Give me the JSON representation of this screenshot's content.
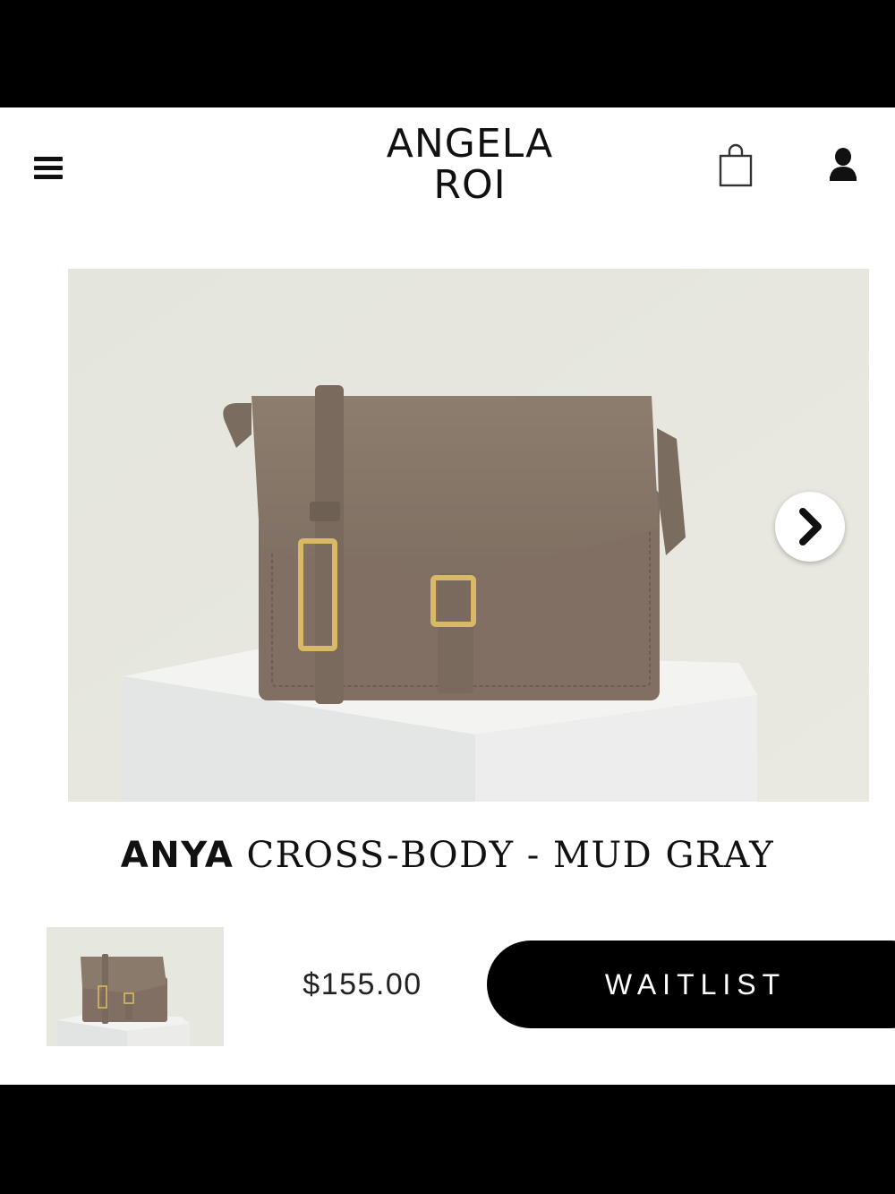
{
  "brand": {
    "line1": "ANGELA",
    "line2": "ROI"
  },
  "icons": {
    "menu": "hamburger-menu-icon",
    "cart": "shopping-bag-icon",
    "account": "user-icon",
    "next": "chevron-right-icon"
  },
  "product": {
    "name": "ANYA",
    "variant": " CROSS-BODY - MUD GRAY",
    "price": "$155.00",
    "cta_label": "WAITLIST"
  },
  "colors": {
    "bag": "#8a7a6c",
    "hardware": "#d9b866",
    "cta_bg": "#000000",
    "cta_text": "#ffffff"
  }
}
